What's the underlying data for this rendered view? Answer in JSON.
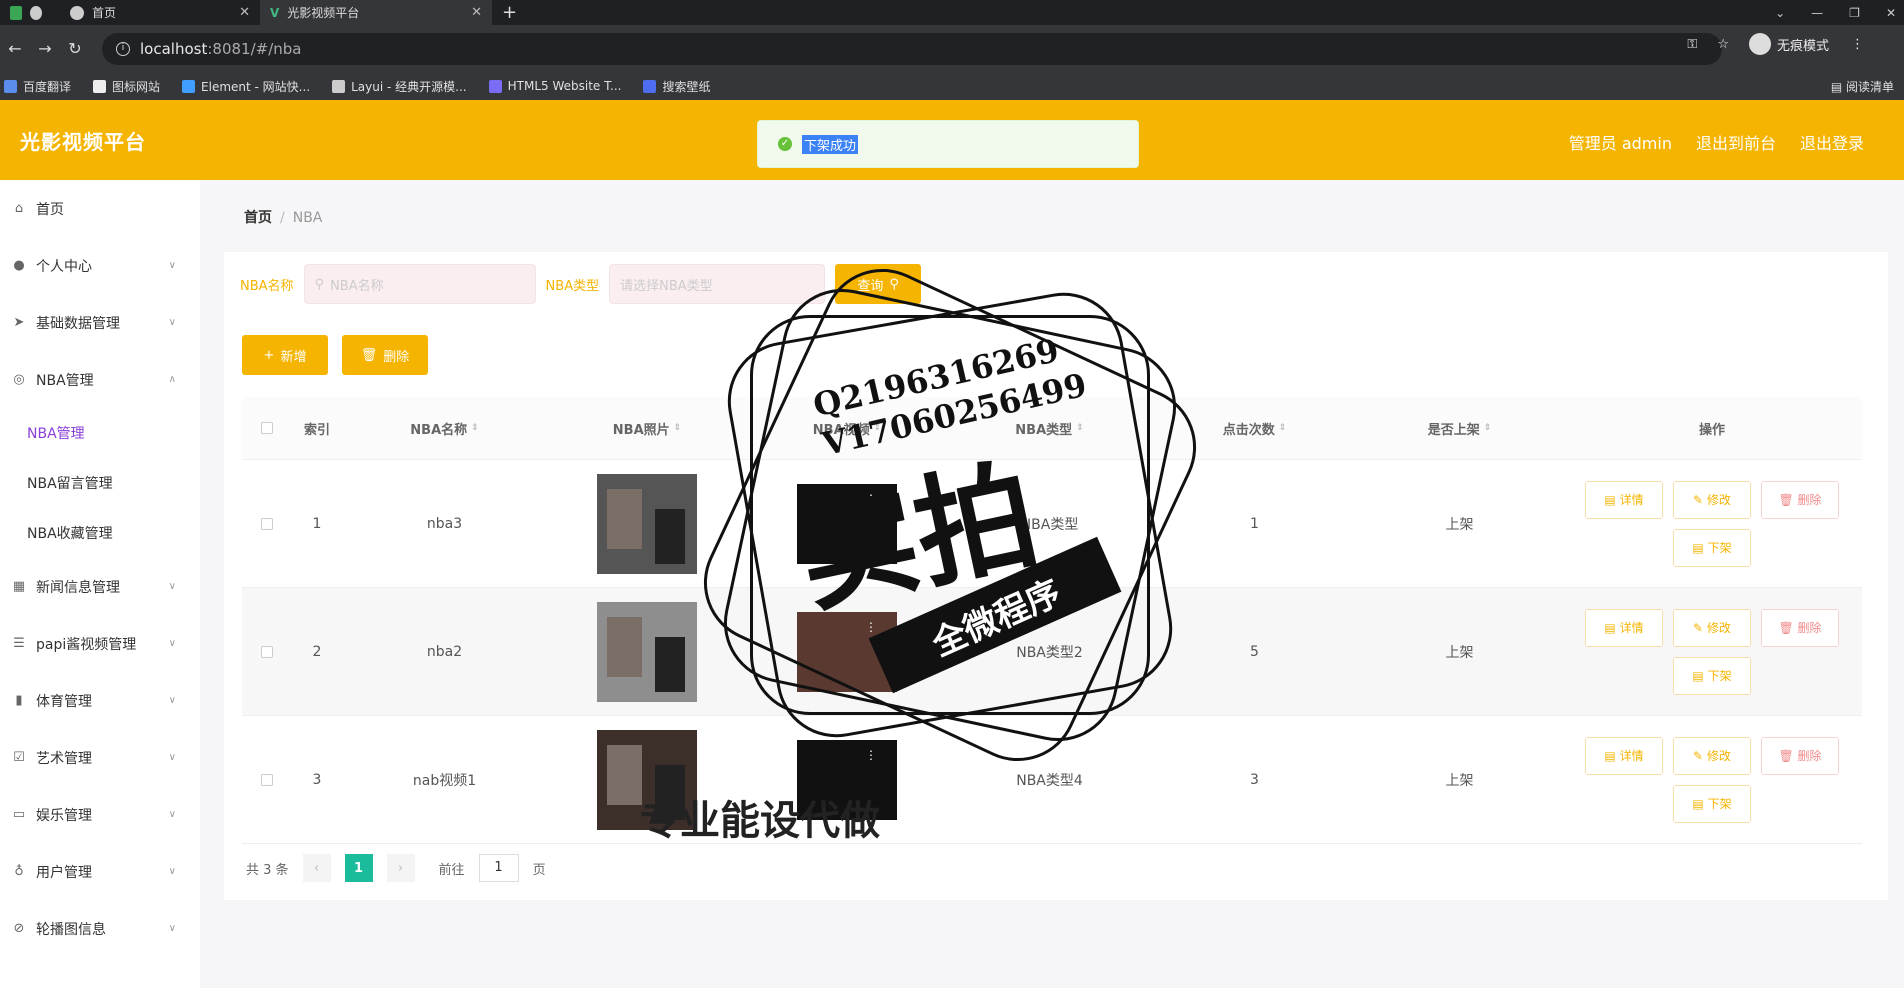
{
  "browser": {
    "tabs": [
      {
        "label": "首页"
      },
      {
        "label": "光影视频平台"
      }
    ],
    "url_host": "localhost",
    "url_rest": ":8081/#/nba",
    "profile_label": "无痕模式",
    "bookmarks": [
      "百度翻译",
      "图标网站",
      "Element - 网站快...",
      "Layui - 经典开源模...",
      "HTML5 Website T...",
      "搜索壁纸"
    ],
    "reading_list": "阅读清单"
  },
  "header": {
    "title": "光影视频平台",
    "links": [
      "管理员 admin",
      "退出到前台",
      "退出登录"
    ],
    "toast": "下架成功"
  },
  "sidebar": {
    "items": [
      {
        "label": "首页",
        "icon": "home-icon"
      },
      {
        "label": "个人中心",
        "icon": "user-icon"
      },
      {
        "label": "基础数据管理",
        "icon": "send-icon"
      },
      {
        "label": "NBA管理",
        "icon": "target-icon"
      },
      {
        "label": "NBA管理"
      },
      {
        "label": "NBA留言管理"
      },
      {
        "label": "NBA收藏管理"
      },
      {
        "label": "新闻信息管理",
        "icon": "news-icon"
      },
      {
        "label": "papi酱视频管理",
        "icon": "list-icon"
      },
      {
        "label": "体育管理",
        "icon": "chart-icon"
      },
      {
        "label": "艺术管理",
        "icon": "check-icon"
      },
      {
        "label": "娱乐管理",
        "icon": "chat-icon"
      },
      {
        "label": "用户管理",
        "icon": "mic-icon"
      },
      {
        "label": "轮播图信息",
        "icon": "compass-icon"
      }
    ]
  },
  "breadcrumb": {
    "home": "首页",
    "current": "NBA"
  },
  "search": {
    "name_label": "NBA名称",
    "name_placeholder": "NBA名称",
    "type_label": "NBA类型",
    "type_placeholder": "请选择NBA类型",
    "query_button": "查询"
  },
  "actions": {
    "add": "新增",
    "delete": "删除"
  },
  "table": {
    "headers": [
      "索引",
      "NBA名称",
      "NBA照片",
      "NBA视频",
      "NBA类型",
      "点击次数",
      "是否上架",
      "操作"
    ],
    "rows": [
      {
        "index": "1",
        "name": "nba3",
        "type": "NBA类型",
        "clicks": "1",
        "status": "上架"
      },
      {
        "index": "2",
        "name": "nba2",
        "type": "NBA类型2",
        "clicks": "5",
        "status": "上架"
      },
      {
        "index": "3",
        "name": "nab视频1",
        "type": "NBA类型4",
        "clicks": "3",
        "status": "上架"
      }
    ],
    "op_labels": {
      "detail": "详情",
      "edit": "修改",
      "delete": "删除",
      "off": "下架"
    }
  },
  "pagination": {
    "total": "共 3 条",
    "current": "1",
    "goto": "前往",
    "goto_value": "1",
    "page_unit": "页"
  },
  "watermark": {
    "phone1": "Q2196316269",
    "phone2": "V17060256499",
    "big": "实拍",
    "ribbon": "全微程序",
    "bottom_text": "专业能设代做"
  }
}
